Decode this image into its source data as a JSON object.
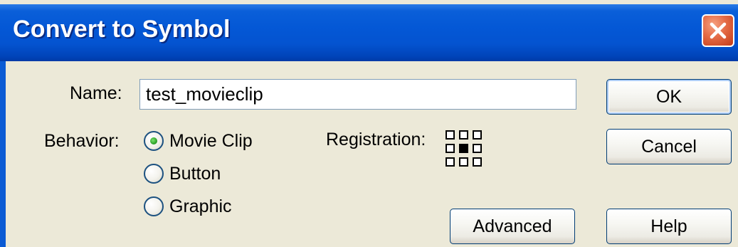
{
  "dialog": {
    "title": "Convert to Symbol"
  },
  "form": {
    "name_label": "Name:",
    "name_value": "test_movieclip",
    "behavior_label": "Behavior:",
    "behaviors": [
      {
        "label": "Movie Clip",
        "selected": true
      },
      {
        "label": "Button",
        "selected": false
      },
      {
        "label": "Graphic",
        "selected": false
      }
    ],
    "registration_label": "Registration:",
    "registration_selected": "center"
  },
  "buttons": {
    "ok": "OK",
    "cancel": "Cancel",
    "help": "Help",
    "advanced": "Advanced"
  },
  "icons": {
    "close": "close-icon",
    "registration": "registration-grid-icon"
  },
  "colors": {
    "titlebar": "#0458d6",
    "close_button": "#e46a45",
    "dialog_background": "#ece9d8",
    "radio_selected": "#2fa42a"
  }
}
